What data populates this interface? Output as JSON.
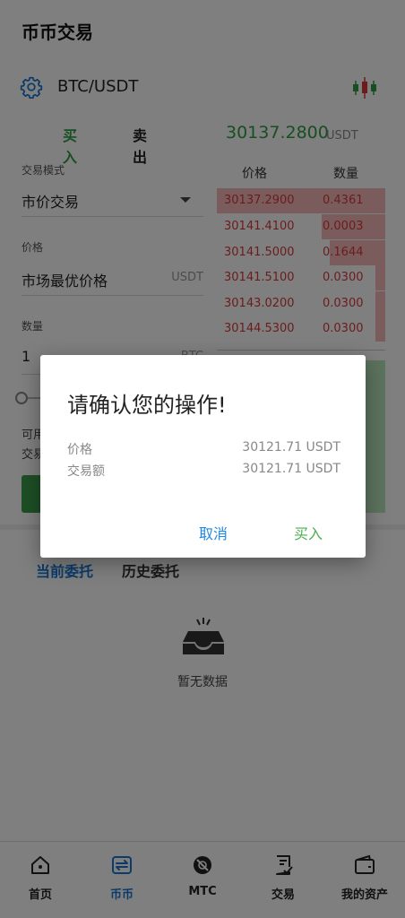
{
  "header": {
    "title": "币币交易"
  },
  "pair": {
    "symbol": "BTC/USDT"
  },
  "trade_tabs": {
    "buy": "买入",
    "sell": "卖出"
  },
  "last": {
    "price": "30137.2800",
    "unit": "USDT"
  },
  "form": {
    "mode_label": "交易模式",
    "mode_value": "市价交易",
    "price_label": "价格",
    "price_value": "市场最优价格",
    "price_unit": "USDT",
    "qty_label": "数量",
    "qty_value": "1",
    "qty_unit": "BTC",
    "available_prefix": "可用",
    "amount_prefix": "交易"
  },
  "orderbook": {
    "price_header": "价格",
    "qty_header": "数量",
    "asks": [
      {
        "price": "30137.2900",
        "qty": "0.4361",
        "depth": 1.0
      },
      {
        "price": "30141.4100",
        "qty": "0.0003",
        "depth": 0.38
      },
      {
        "price": "30141.5000",
        "qty": "0.1644",
        "depth": 0.33
      },
      {
        "price": "30141.5100",
        "qty": "0.0300",
        "depth": 0.06
      },
      {
        "price": "30143.0200",
        "qty": "0.0300",
        "depth": 0.06
      },
      {
        "price": "30144.5300",
        "qty": "0.0300",
        "depth": 0.06
      }
    ]
  },
  "orders_tabs": {
    "current": "当前委托",
    "history": "历史委托"
  },
  "empty": {
    "text": "暂无数据"
  },
  "nav": {
    "home": "首页",
    "coin": "币币",
    "mtc": "MTC",
    "trade": "交易",
    "assets": "我的资产"
  },
  "dialog": {
    "title": "请确认您的操作!",
    "price_label": "价格",
    "price_value": "30121.71 USDT",
    "amount_label": "交易额",
    "amount_value": "30121.71 USDT",
    "cancel": "取消",
    "confirm": "买入"
  },
  "colors": {
    "buy": "#2f9e44",
    "sell": "#d9393b",
    "accent": "#1976d2"
  }
}
